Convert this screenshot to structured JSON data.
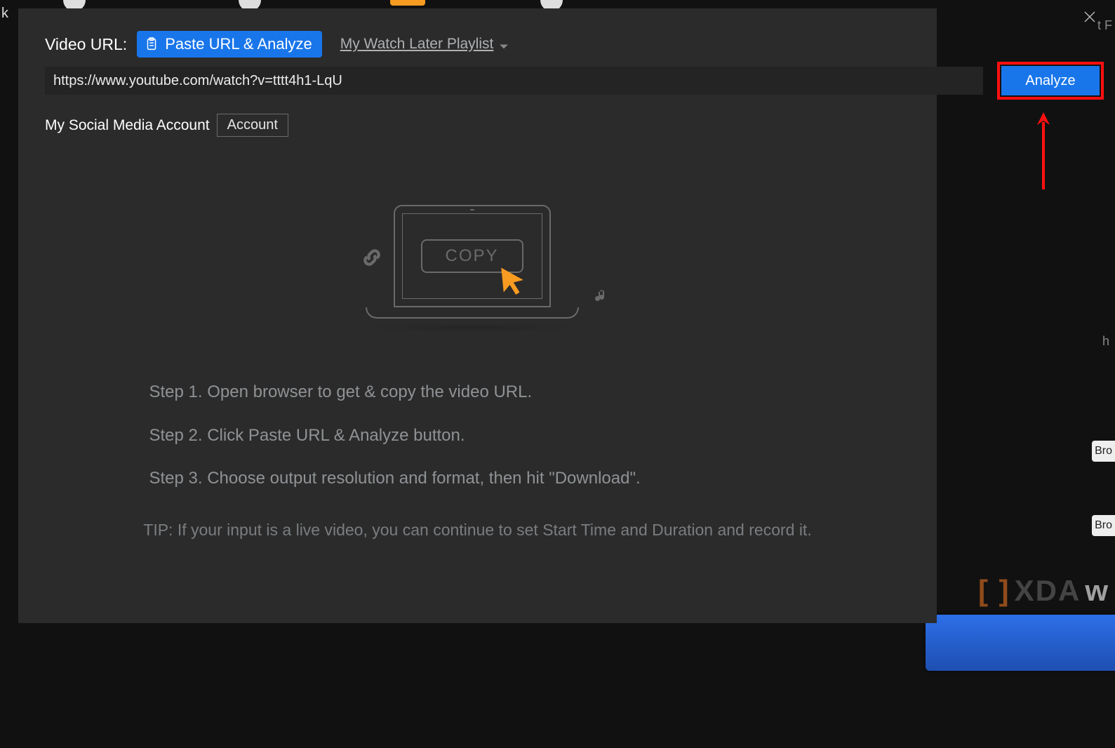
{
  "header": {
    "video_url_label": "Video URL:",
    "paste_button": "Paste URL & Analyze",
    "watch_later": "My Watch Later Playlist"
  },
  "url": {
    "value": "https://www.youtube.com/watch?v=tttt4h1-LqU",
    "analyze_button": "Analyze"
  },
  "social": {
    "label": "My Social Media Account",
    "account_button": "Account"
  },
  "illustration": {
    "copy_label": "COPY"
  },
  "steps": {
    "s1": "Step 1. Open browser to get & copy the video URL.",
    "s2": "Step 2. Click Paste URL & Analyze button.",
    "s3": "Step 3. Choose output resolution and format, then hit \"Download\"."
  },
  "tip": "TIP: If your input is a live video, you can continue to set Start Time and Duration and record it.",
  "background": {
    "k": "k",
    "tF": "t F",
    "h": "h",
    "bro1": "Bro",
    "bro2": "Bro",
    "xda": "XDA",
    "w": "w"
  }
}
